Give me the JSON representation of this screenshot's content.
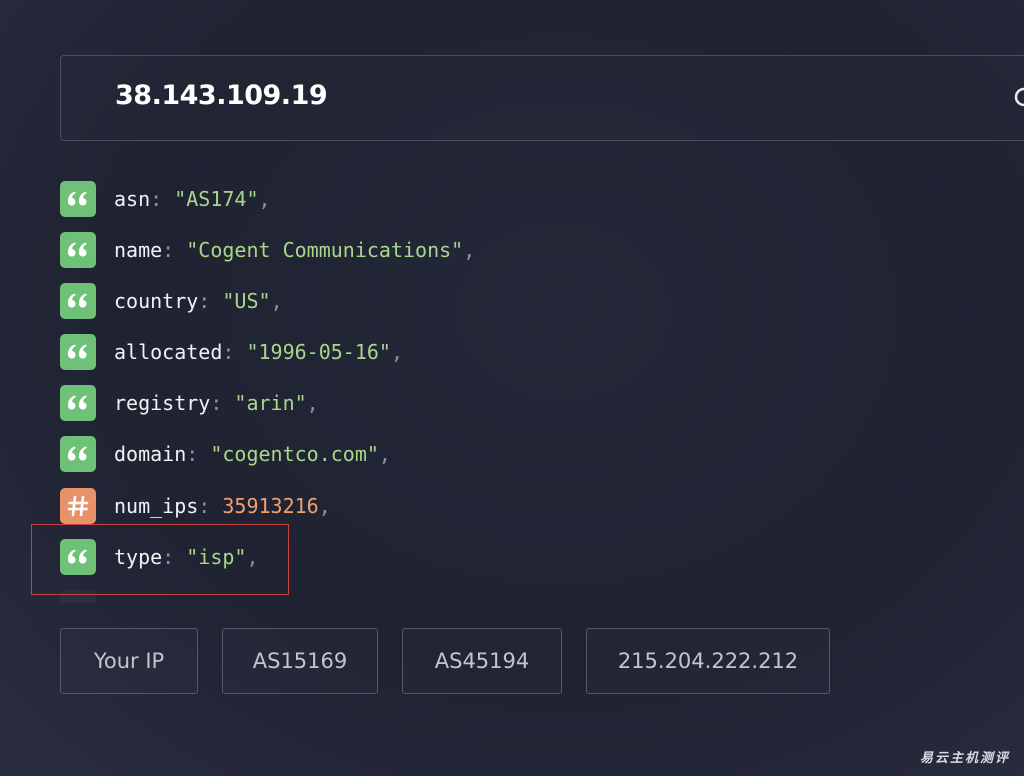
{
  "search": {
    "value": "38.143.109.19"
  },
  "fields": [
    {
      "key": "asn",
      "value": "\"AS174\"",
      "type": "string"
    },
    {
      "key": "name",
      "value": "\"Cogent Communications\"",
      "type": "string"
    },
    {
      "key": "country",
      "value": "\"US\"",
      "type": "string"
    },
    {
      "key": "allocated",
      "value": "\"1996-05-16\"",
      "type": "string"
    },
    {
      "key": "registry",
      "value": "\"arin\"",
      "type": "string"
    },
    {
      "key": "domain",
      "value": "\"cogentco.com\"",
      "type": "string"
    },
    {
      "key": "num_ips",
      "value": "35913216",
      "type": "number"
    },
    {
      "key": "type",
      "value": "\"isp\"",
      "type": "string"
    }
  ],
  "punctuation": {
    "colon": ":",
    "comma": ","
  },
  "quick_links": [
    "Your IP",
    "AS15169",
    "AS45194",
    "215.204.222.212"
  ],
  "watermark": "易云主机测评",
  "colors": {
    "string_badge": "#6fc178",
    "number_badge": "#e8926a",
    "string_value": "#a8d78c",
    "number_value": "#f0a070",
    "highlight": "#c9433e"
  },
  "icons": {
    "string": "quote-icon",
    "number": "hash-icon",
    "search": "search-icon"
  }
}
